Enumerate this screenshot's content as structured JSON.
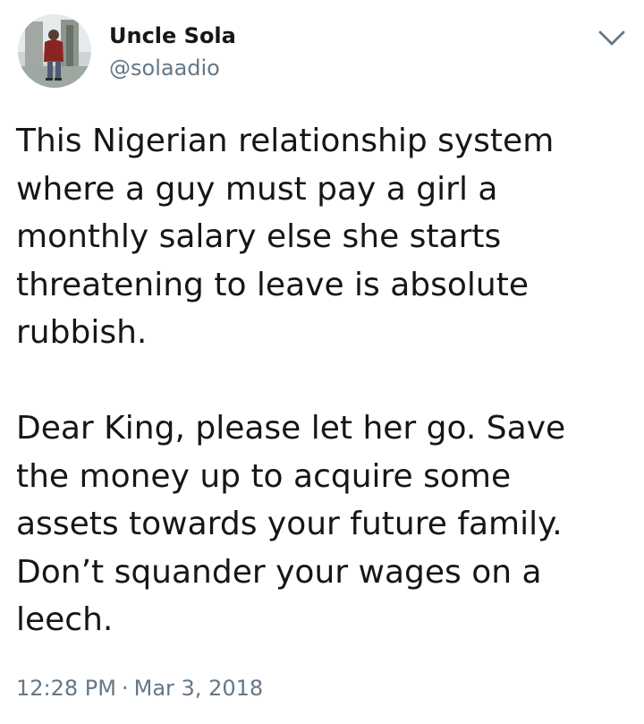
{
  "tweet": {
    "author": {
      "name": "Uncle Sola",
      "handle": "@solaadio"
    },
    "text": {
      "paragraph_1": [
        "This Nigerian relationship system",
        "where a guy must pay a girl a",
        "monthly salary else she starts",
        "threatening to leave is absolute",
        "rubbish."
      ],
      "paragraph_2": [
        "Dear King, please let her go. Save",
        "the money up to acquire some",
        "assets towards your future family.",
        "Don’t squander your wages on a",
        "leech."
      ]
    },
    "time": "12:28 PM",
    "separator": "·",
    "date": "Mar 3, 2018"
  },
  "icons": {
    "caret": "chevron-down-icon"
  },
  "colors": {
    "text": "#14171a",
    "secondary": "#657786",
    "background": "#ffffff"
  }
}
